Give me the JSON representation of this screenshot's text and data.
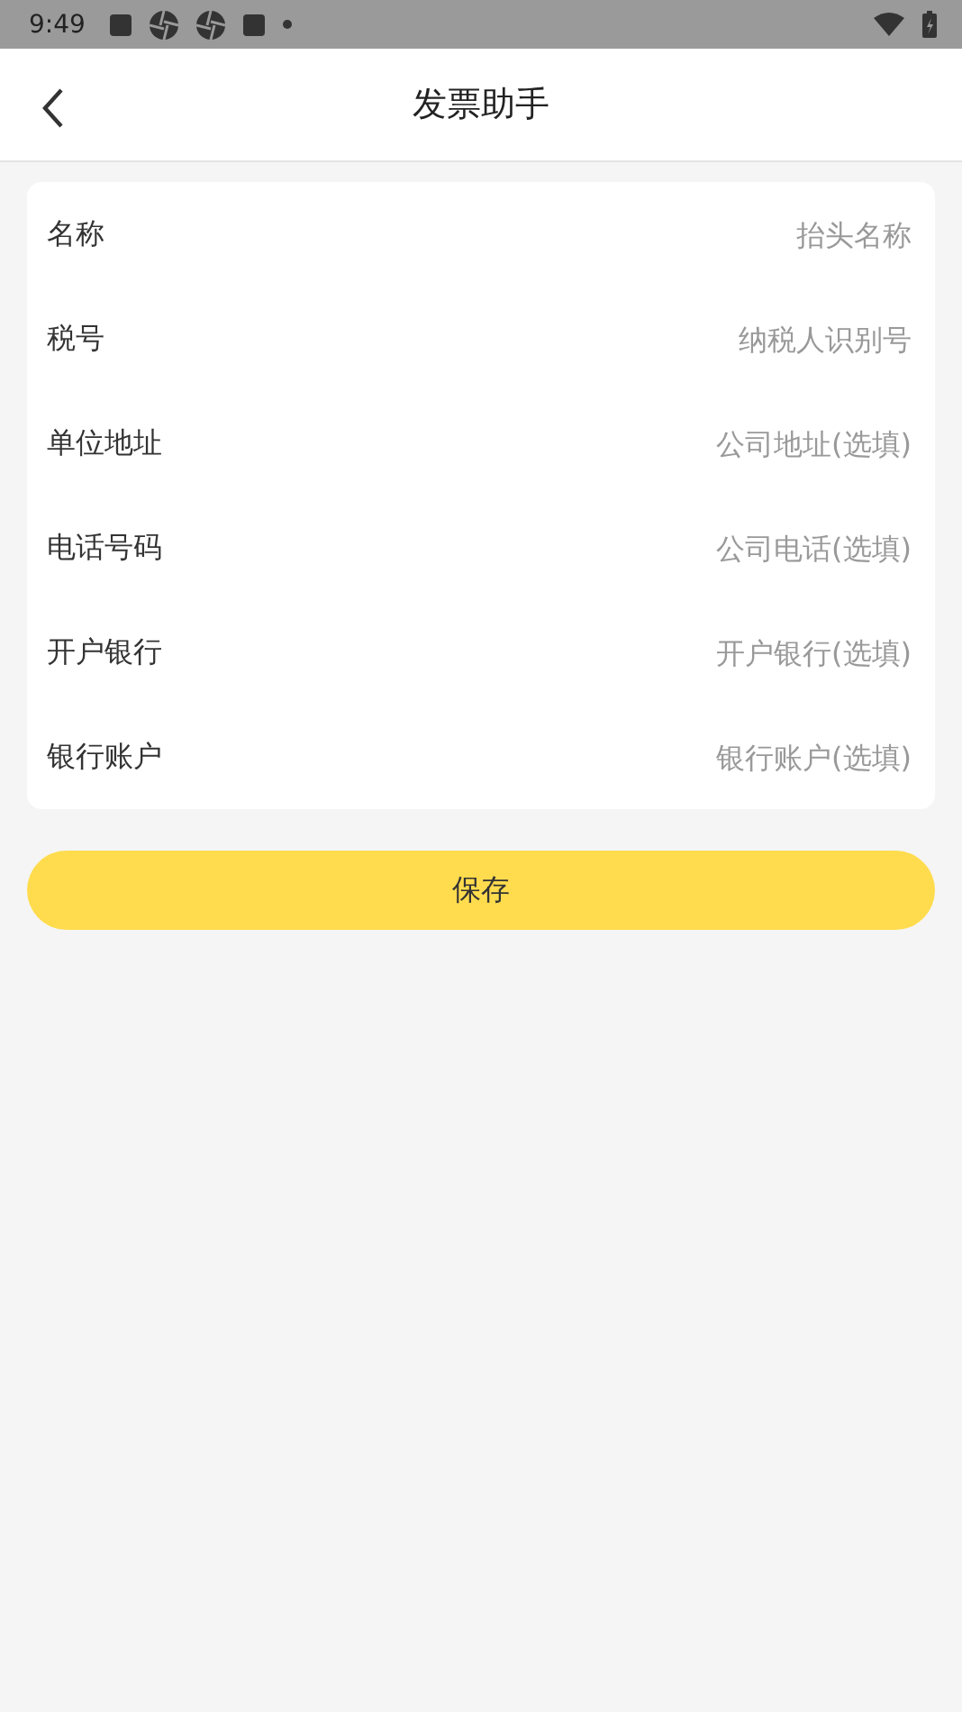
{
  "status_bar": {
    "time": "9:49"
  },
  "header": {
    "title": "发票助手"
  },
  "fields": [
    {
      "label": "名称",
      "placeholder": "抬头名称"
    },
    {
      "label": "税号",
      "placeholder": "纳税人识别号"
    },
    {
      "label": "单位地址",
      "placeholder": "公司地址(选填)"
    },
    {
      "label": "电话号码",
      "placeholder": "公司电话(选填)"
    },
    {
      "label": "开户银行",
      "placeholder": "开户银行(选填)"
    },
    {
      "label": "银行账户",
      "placeholder": "银行账户(选填)"
    }
  ],
  "save_button": "保存"
}
